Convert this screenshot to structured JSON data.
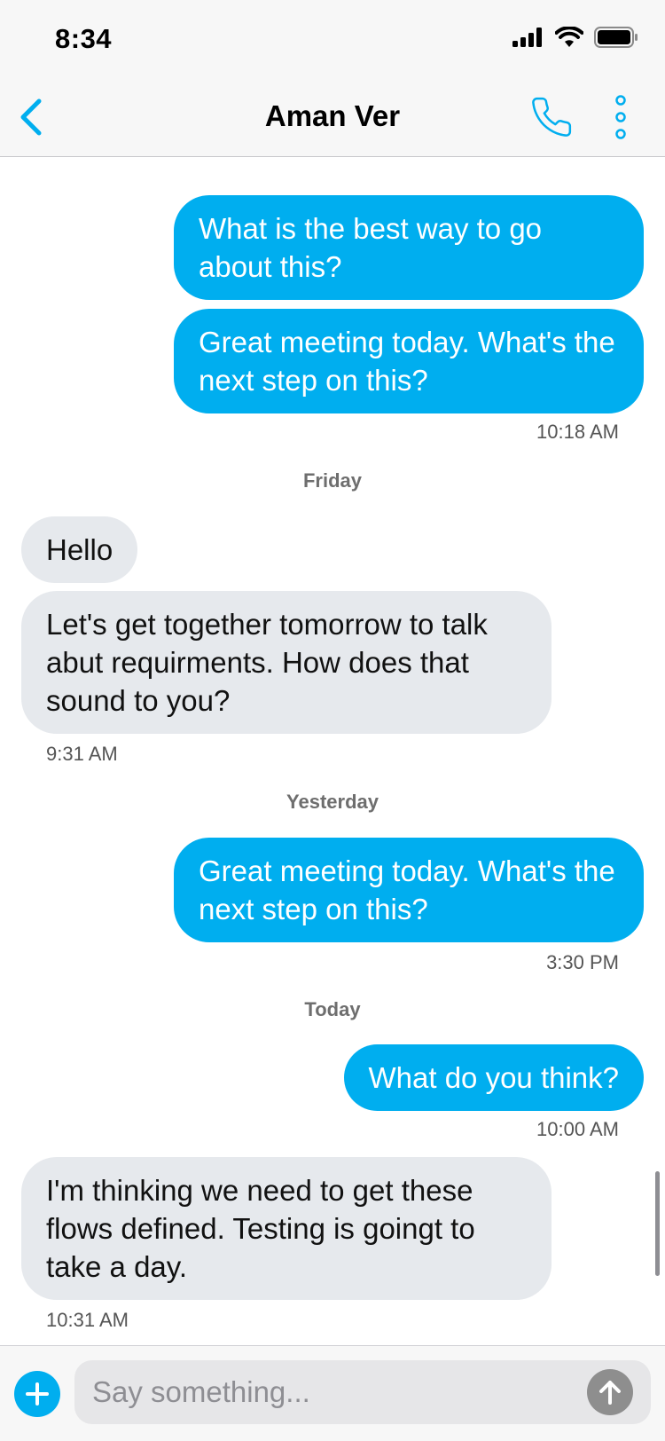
{
  "status_bar": {
    "time": "8:34"
  },
  "nav": {
    "title": "Aman Ver"
  },
  "messages": [
    {
      "direction": "outgoing",
      "text": "What is the best way to go about this?"
    },
    {
      "direction": "outgoing",
      "text": "Great meeting today. What's the next step on this?"
    },
    {
      "timestamp": "10:18 AM"
    },
    {
      "day": "Friday"
    },
    {
      "direction": "incoming",
      "text": "Hello"
    },
    {
      "direction": "incoming",
      "text": "Let's get together tomorrow to talk abut requirments. How does that sound to you?"
    },
    {
      "timestamp": "9:31 AM"
    },
    {
      "day": "Yesterday"
    },
    {
      "direction": "outgoing",
      "text": "Great meeting today. What's the next step on this?"
    },
    {
      "timestamp": "3:30 PM"
    },
    {
      "day": "Today"
    },
    {
      "direction": "outgoing",
      "text": "What do you think?"
    },
    {
      "timestamp": "10:00 AM"
    },
    {
      "direction": "incoming",
      "text": "I'm thinking we need to get these flows defined. Testing is goingt to take a day."
    },
    {
      "timestamp": "10:31 AM"
    }
  ],
  "composer": {
    "placeholder": "Say something..."
  },
  "colors": {
    "accent": "#00aeef",
    "incoming_bubble": "#e6e9ed"
  }
}
